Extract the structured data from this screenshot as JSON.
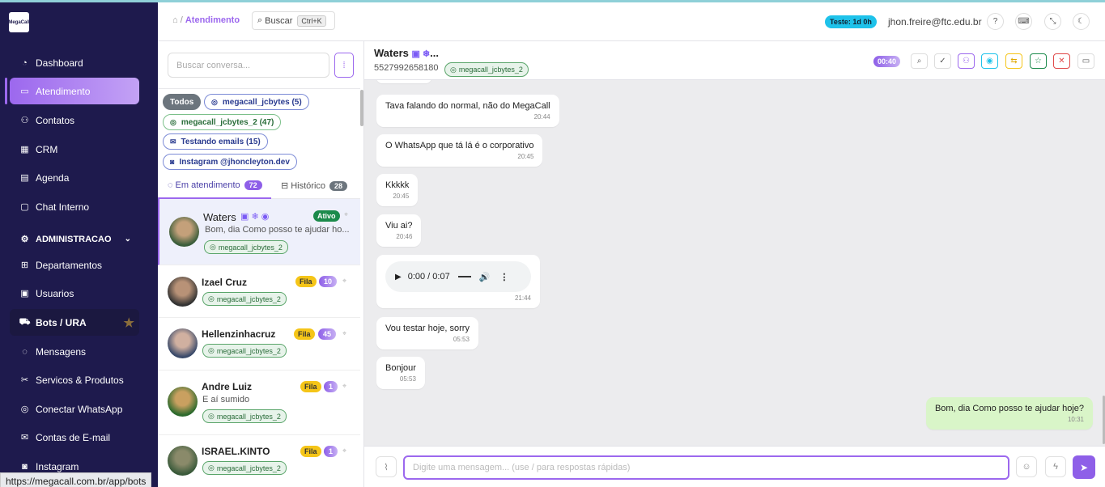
{
  "sidebar": {
    "logo_text": "MegaCall",
    "items": [
      {
        "label": "Dashboard",
        "icon": "dashboard-icon"
      },
      {
        "label": "Atendimento",
        "icon": "inbox-icon",
        "active": true
      },
      {
        "label": "Contatos",
        "icon": "contacts-icon"
      },
      {
        "label": "CRM",
        "icon": "crm-icon"
      },
      {
        "label": "Agenda",
        "icon": "calendar-icon"
      },
      {
        "label": "Chat Interno",
        "icon": "chat-icon"
      },
      {
        "label": "ADMINISTRACAO",
        "icon": "gear-icon",
        "section": true
      },
      {
        "label": "Departamentos",
        "icon": "departments-icon"
      },
      {
        "label": "Usuarios",
        "icon": "users-icon"
      },
      {
        "label": "Bots / URA",
        "icon": "bot-icon"
      },
      {
        "label": "Mensagens",
        "icon": "messages-icon"
      },
      {
        "label": "Servicos & Produtos",
        "icon": "scissors-icon"
      },
      {
        "label": "Conectar WhatsApp",
        "icon": "whatsapp-icon"
      },
      {
        "label": "Contas de E-mail",
        "icon": "mail-icon"
      },
      {
        "label": "Instagram",
        "icon": "instagram-icon"
      }
    ]
  },
  "status_url": "https://megacall.com.br/app/bots",
  "topbar": {
    "breadcrumb_sep": "/",
    "breadcrumb_current": "Atendimento",
    "search_label": "Buscar",
    "search_shortcut": "Ctrl+K",
    "trial_badge": "Teste: 1d 0h",
    "user_email": "jhon.freire@ftc.edu.br",
    "help_label": "?"
  },
  "conversations": {
    "search_placeholder": "Buscar conversa...",
    "filters": [
      {
        "label": "Todos"
      },
      {
        "label": "megacall_jcbytes (5)"
      },
      {
        "label": "megacall_jcbytes_2 (47)"
      },
      {
        "label": "Testando emails (15)"
      },
      {
        "label": "Instagram @jhoncleyton.dev"
      }
    ],
    "tabs": [
      {
        "label": "Em atendimento",
        "count": "72"
      },
      {
        "label": "Histórico",
        "count": "28"
      }
    ],
    "list": [
      {
        "name": "Waters",
        "preview": "Bom, dia Como posso te ajudar ho...",
        "channel": "megacall_jcbytes_2",
        "status": "Ativo",
        "count": ""
      },
      {
        "name": "Izael Cruz",
        "preview": "",
        "channel": "megacall_jcbytes_2",
        "status": "Fila",
        "count": "10"
      },
      {
        "name": "Hellenzinhacruz",
        "preview": "",
        "channel": "megacall_jcbytes_2",
        "status": "Fila",
        "count": "45"
      },
      {
        "name": "Andre Luiz",
        "preview": "E aí sumido",
        "channel": "megacall_jcbytes_2",
        "status": "Fila",
        "count": "1"
      },
      {
        "name": "ISRAEL.KINTO",
        "preview": "",
        "channel": "megacall_jcbytes_2",
        "status": "Fila",
        "count": "1"
      }
    ]
  },
  "chat": {
    "name": "Waters",
    "name_suffix": "...",
    "phone": "5527992658180",
    "channel": "megacall_jcbytes_2",
    "timer": "00:40",
    "messages": [
      {
        "text": "Tava falando do normal, não do MegaCall",
        "time": "20:44"
      },
      {
        "text": "O WhatsApp que tá lá é o corporativo",
        "time": "20:45"
      },
      {
        "text": "Kkkkk",
        "time": "20:45"
      },
      {
        "text": "Viu ai?",
        "time": "20:46"
      },
      {
        "audio_time": "0:00 / 0:07",
        "time": "21:44"
      },
      {
        "text": "Vou testar hoje, sorry",
        "time": "05:53"
      },
      {
        "text": "Bonjour",
        "time": "05:53"
      },
      {
        "text": "Bom, dia Como posso te ajudar hoje?",
        "time": "10:31",
        "outgoing": true
      }
    ],
    "input_placeholder": "Digite uma mensagem... (use / para respostas rápidas)"
  },
  "colors": {
    "sidebar_bg": "#1e1a4d",
    "accent": "#9c68ee",
    "active_status": "#1b8a4b",
    "queue_status": "#f5c518",
    "outgoing_bubble": "#d9f5c8"
  }
}
